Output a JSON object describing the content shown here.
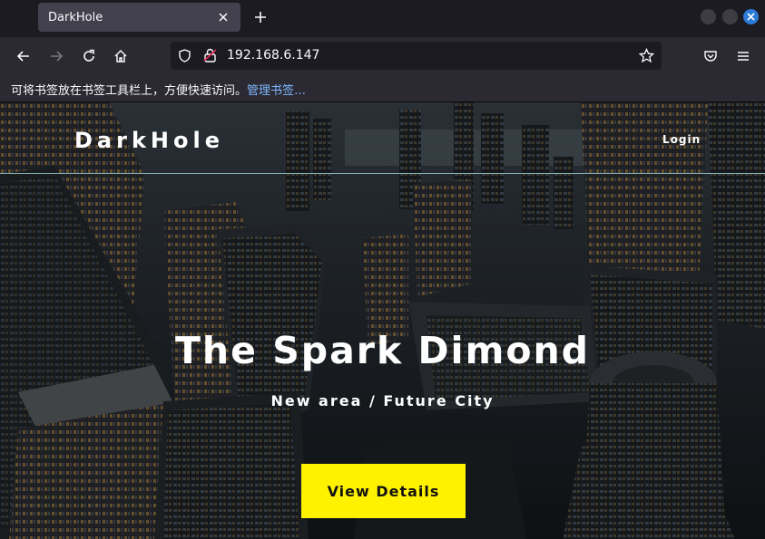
{
  "browser": {
    "tab_title": "DarkHole",
    "url": "192.168.6.147",
    "bookmarks_hint": "可将书签放在书签工具栏上，方便快速访问。",
    "bookmarks_link": "管理书签…"
  },
  "site": {
    "brand": "DarkHole",
    "login": "Login",
    "hero_title": "The Spark Dimond",
    "hero_subtitle": "New area / Future City",
    "cta_label": "View Details"
  },
  "colors": {
    "accent_button": "#fff200",
    "tab_active": "#42414d",
    "link": "#80b8ff"
  }
}
